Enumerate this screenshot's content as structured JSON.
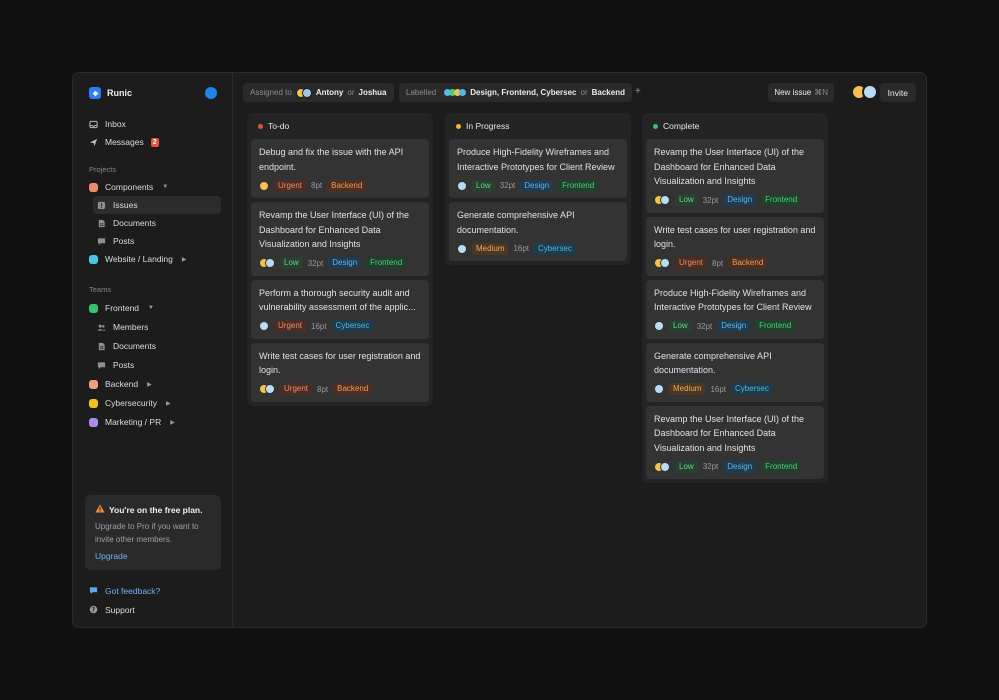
{
  "app": {
    "name": "Runic"
  },
  "colors": {
    "urgent_fg": "#f08a5d",
    "urgent_bg": "#4a2e26",
    "low_fg": "#6fd08c",
    "low_bg": "#27402f",
    "medium_fg": "#f2a65a",
    "medium_bg": "#4a3724",
    "design_fg": "#5bb6f5",
    "design_bg": "#213a4d",
    "frontend_fg": "#4dcf7a",
    "frontend_bg": "#213f2c",
    "backend_fg": "#f59a5a",
    "backend_bg": "#4a2f22",
    "cybersec_fg": "#4fb8e8",
    "cybersec_bg": "#1f3a48"
  },
  "sidebar": {
    "inbox": "Inbox",
    "messages": "Messages",
    "messages_count": "2",
    "projects_label": "Projects",
    "projects": [
      {
        "label": "Components",
        "color": "#f08a6a"
      },
      {
        "label": "Website / Landing",
        "color": "#4cc3e8"
      }
    ],
    "components_sub": [
      "Issues",
      "Documents",
      "Posts"
    ],
    "teams_label": "Teams",
    "teams": [
      {
        "label": "Frontend",
        "color": "#35c46e"
      },
      {
        "label": "Backend",
        "color": "#f0a07a"
      },
      {
        "label": "Cybersecurity",
        "color": "#f2c21b"
      },
      {
        "label": "Marketing / PR",
        "color": "#b08cf0"
      }
    ],
    "frontend_sub": [
      "Members",
      "Documents",
      "Posts"
    ],
    "plan": {
      "title": "You're on the free plan.",
      "text": "Upgrade to Pro if you want to invite other members.",
      "link": "Upgrade"
    },
    "feedback": "Got feedback?",
    "support": "Support"
  },
  "toolbar": {
    "assigned_prefix": "Assigned to",
    "assigned_a": "Antony",
    "or": "or",
    "assigned_b": "Joshua",
    "labelled_prefix": "Labelled",
    "labels_list": "Design, Frontend, Cybersec",
    "labels_last": "Backend",
    "add": "+",
    "new_issue": "New issue",
    "new_issue_kbd": "⌘N",
    "invite": "Invite"
  },
  "columns": [
    {
      "title": "To-do",
      "color": "#e5533b",
      "cards": [
        {
          "title": "Debug and fix the issue with the API endpoint.",
          "priority": "Urgent",
          "points": "8pt",
          "tags": [
            "Backend"
          ],
          "avatars": 1
        },
        {
          "title": "Revamp the User Interface (UI) of the Dashboard for Enhanced Data Visualization and Insights",
          "priority": "Low",
          "points": "32pt",
          "tags": [
            "Design",
            "Frontend"
          ],
          "avatars": 2
        },
        {
          "title": "Perform a thorough security audit and vulnerability assessment of the applic...",
          "priority": "Urgent",
          "points": "16pt",
          "tags": [
            "Cybersec"
          ],
          "avatars": 1
        },
        {
          "title": "Write test cases for user registration and login.",
          "priority": "Urgent",
          "points": "8pt",
          "tags": [
            "Backend"
          ],
          "avatars": 2
        }
      ]
    },
    {
      "title": "In Progress",
      "color": "#f2b53a",
      "cards": [
        {
          "title": "Produce High-Fidelity Wireframes and Interactive Prototypes for Client Review",
          "priority": "Low",
          "points": "32pt",
          "tags": [
            "Design",
            "Frontend"
          ],
          "avatars": 1
        },
        {
          "title": "Generate comprehensive API documentation.",
          "priority": "Medium",
          "points": "16pt",
          "tags": [
            "Cybersec"
          ],
          "avatars": 1
        }
      ]
    },
    {
      "title": "Complete",
      "color": "#35c46e",
      "cards": [
        {
          "title": "Revamp the User Interface (UI) of the Dashboard for Enhanced Data Visualization and Insights",
          "priority": "Low",
          "points": "32pt",
          "tags": [
            "Design",
            "Frontend"
          ],
          "avatars": 2
        },
        {
          "title": "Write test cases for user registration and login.",
          "priority": "Urgent",
          "points": "8pt",
          "tags": [
            "Backend"
          ],
          "avatars": 2
        },
        {
          "title": "Produce High-Fidelity Wireframes and Interactive Prototypes for Client Review",
          "priority": "Low",
          "points": "32pt",
          "tags": [
            "Design",
            "Frontend"
          ],
          "avatars": 1
        },
        {
          "title": "Generate comprehensive API documentation.",
          "priority": "Medium",
          "points": "16pt",
          "tags": [
            "Cybersec"
          ],
          "avatars": 1
        },
        {
          "title": "Revamp the User Interface (UI) of the Dashboard for Enhanced Data Visualization and Insights",
          "priority": "Low",
          "points": "32pt",
          "tags": [
            "Design",
            "Frontend"
          ],
          "avatars": 2
        }
      ]
    }
  ]
}
